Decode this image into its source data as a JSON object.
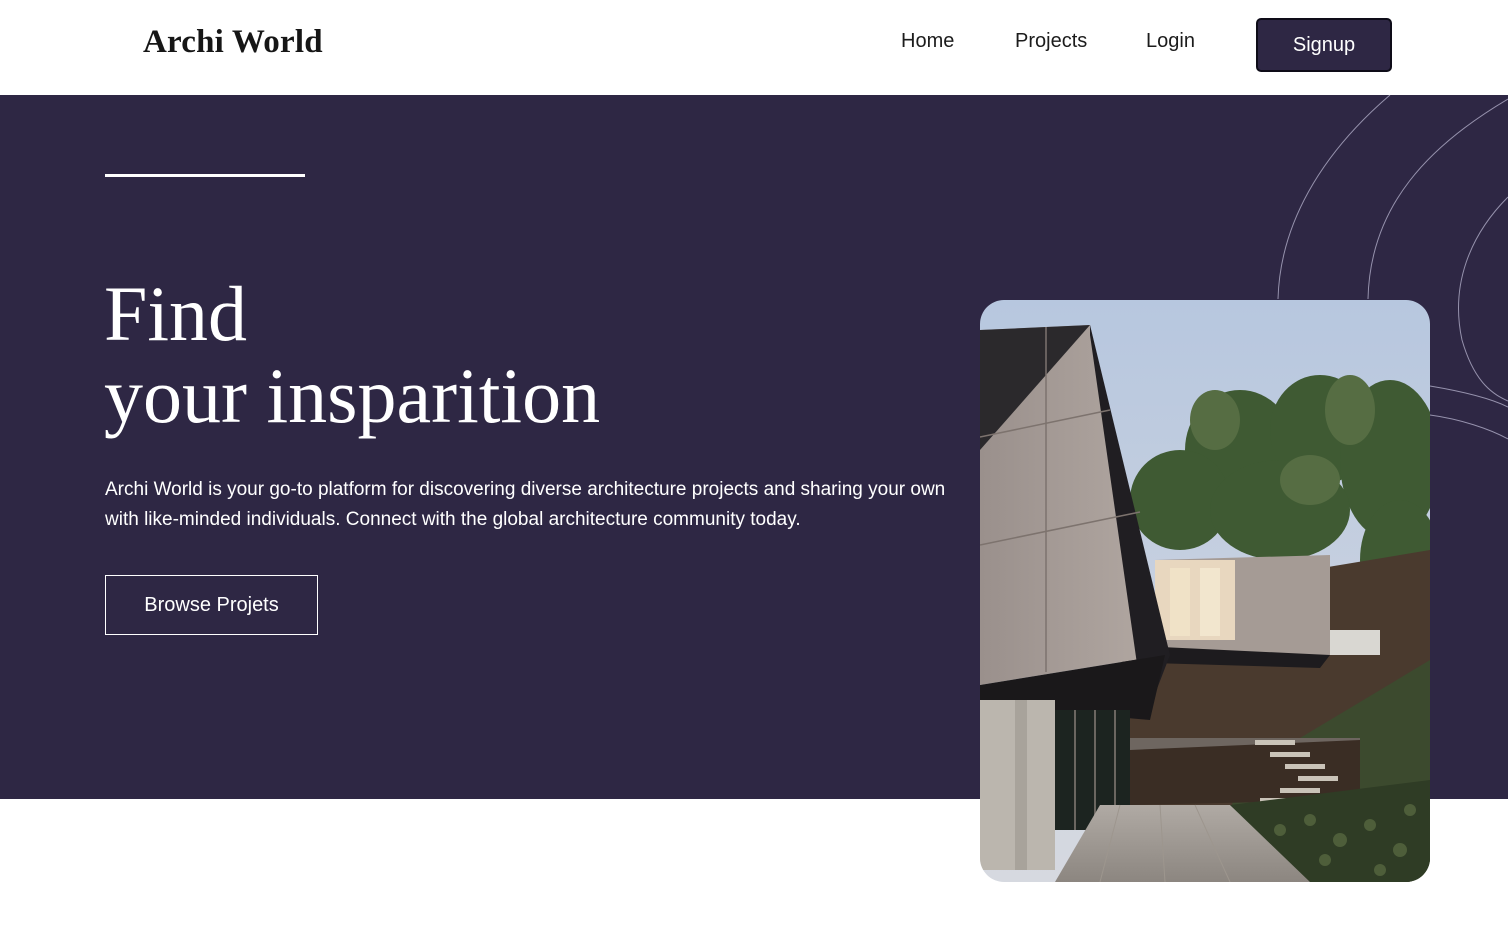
{
  "header": {
    "logo": "Archi World",
    "nav": {
      "home": "Home",
      "projects": "Projects",
      "login": "Login"
    },
    "signup_label": "Signup"
  },
  "hero": {
    "headline_line1": "Find",
    "headline_line2": "your insparition",
    "description": "Archi World is your go-to platform for discovering diverse architecture projects and sharing your own with like-minded individuals. Connect with the global architecture community today.",
    "browse_label": "Browse Projets"
  },
  "icons": {
    "decoration": "contour-lines-icon",
    "photo": "modern-house-photo"
  },
  "colors": {
    "brand_dark": "#2e2744",
    "text_light": "#ffffff",
    "background": "#ffffff"
  }
}
